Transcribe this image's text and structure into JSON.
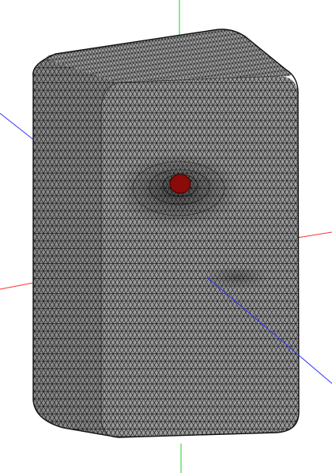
{
  "viewport": {
    "background": "#ffffff"
  },
  "axes": {
    "x_axis_color": "#ff3030",
    "y_axis_color": "#22cc22",
    "z_axis_color": "#3333ff"
  },
  "mesh": {
    "surface_color": "#9c9c9c",
    "top_face_color": "#a8a8a8",
    "side_face_color": "#8a8a8a",
    "wire_color": "#111111",
    "highlight_color": "#8b0a0a",
    "highlight_outline_color": "#3a0000"
  }
}
